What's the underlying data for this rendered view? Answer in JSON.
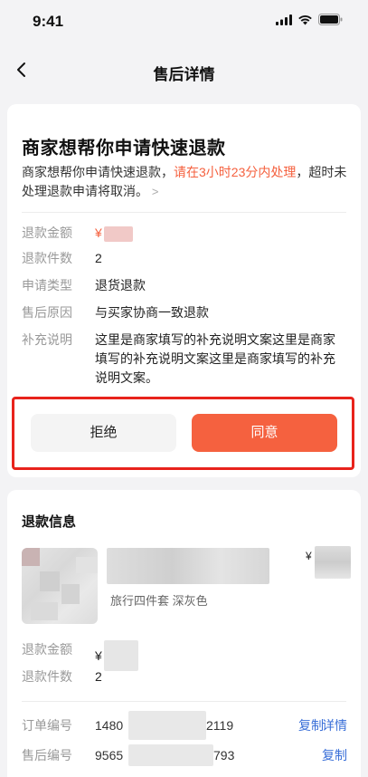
{
  "status_bar": {
    "time": "9:41"
  },
  "nav": {
    "title": "售后详情"
  },
  "notice": {
    "title": "商家想帮你申请快速退款",
    "desc_prefix": "商家想帮你申请快速退款，",
    "desc_highlight": "请在3小时23分内处理",
    "desc_suffix": "，超时未处理退款申请将取消。",
    "more_arrow": ">"
  },
  "details": {
    "refund_amount_label": "退款金额",
    "refund_amount_currency": "¥",
    "refund_count_label": "退款件数",
    "refund_count_value": "2",
    "apply_type_label": "申请类型",
    "apply_type_value": "退货退款",
    "reason_label": "售后原因",
    "reason_value": "与买家协商一致退款",
    "remark_label": "补充说明",
    "remark_value": "这里是商家填写的补充说明文案这里是商家填写的补充说明文案这里是商家填写的补充说明文案。"
  },
  "actions": {
    "reject_label": "拒绝",
    "agree_label": "同意"
  },
  "refund_info": {
    "section_title": "退款信息",
    "product_price_currency": "¥",
    "product_sku": "旅行四件套  深灰色",
    "refund_amount_label": "退款金额",
    "refund_amount_currency": "¥",
    "refund_count_label": "退款件数",
    "refund_count_value": "2",
    "order_no_label": "订单编号",
    "order_no_prefix": "1480",
    "order_no_suffix": "2119",
    "copy_label": "复制",
    "detail_label": "详情",
    "aftersale_no_label": "售后编号",
    "aftersale_no_prefix": "9565",
    "aftersale_no_suffix": "793",
    "copy_label_2": "复制"
  },
  "colors": {
    "accent": "#f5613f",
    "link": "#3a6fd8",
    "highlight_box": "#e8231c"
  }
}
